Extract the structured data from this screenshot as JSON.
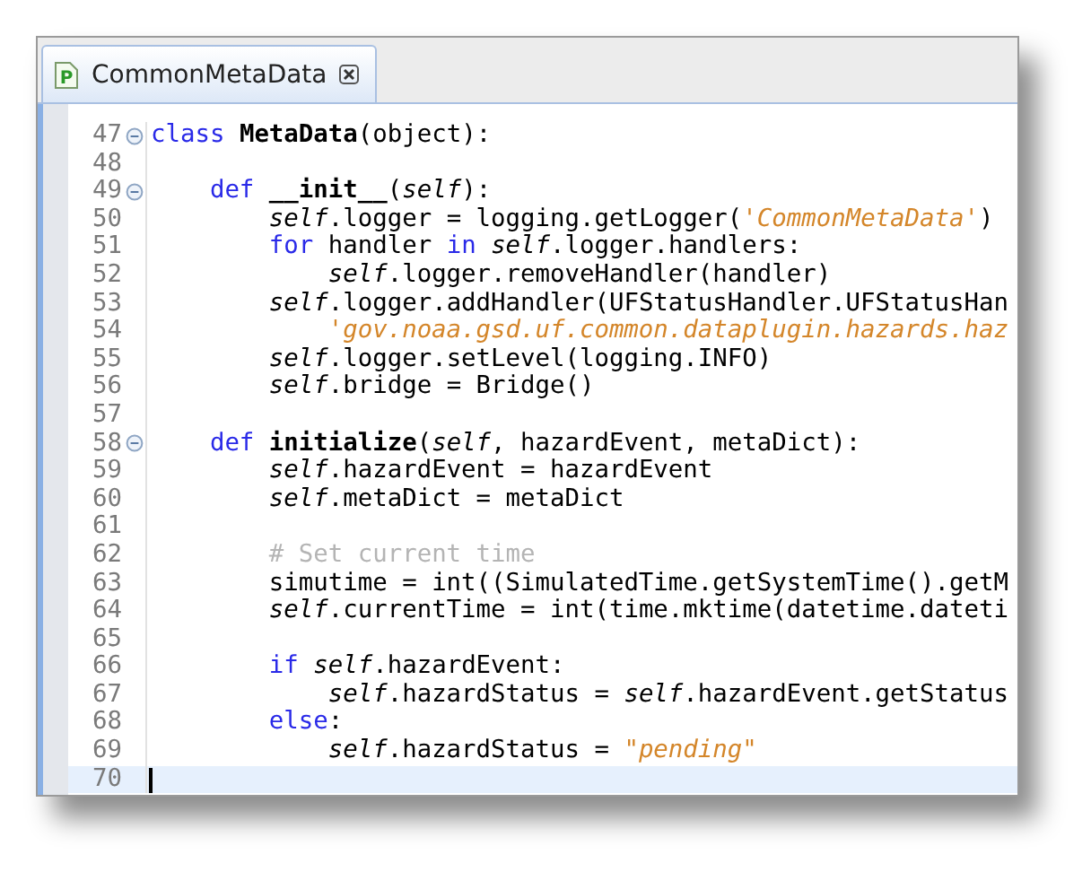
{
  "tab": {
    "icon_letter": "P",
    "label": "CommonMetaData",
    "selected": true
  },
  "lines": [
    {
      "number": "47",
      "fold": true,
      "current": false,
      "tokens": [
        {
          "kind": "kw",
          "t": "class "
        },
        {
          "kind": "bold",
          "t": "MetaData"
        },
        {
          "kind": "plain",
          "t": "(object):"
        }
      ]
    },
    {
      "number": "48",
      "fold": false,
      "current": false
    },
    {
      "number": "49",
      "fold": true,
      "current": false,
      "tokens": [
        {
          "kind": "kw",
          "t": "    def "
        },
        {
          "kind": "bold",
          "t": "__init__"
        },
        {
          "kind": "plain",
          "t": "("
        },
        {
          "kind": "self",
          "t": "self"
        },
        {
          "kind": "plain",
          "t": "):"
        }
      ]
    },
    {
      "number": "50",
      "fold": false,
      "current": false,
      "tokens": [
        {
          "kind": "self",
          "t": "        self"
        },
        {
          "kind": "plain",
          "t": ".logger = logging.getLogger("
        },
        {
          "kind": "str",
          "t": "'CommonMetaData'"
        },
        {
          "kind": "plain",
          "t": ")"
        }
      ]
    },
    {
      "number": "51",
      "fold": false,
      "current": false,
      "tokens": [
        {
          "kind": "kw",
          "t": "        for"
        },
        {
          "kind": "plain",
          "t": " handler "
        },
        {
          "kind": "kw",
          "t": "in "
        },
        {
          "kind": "self",
          "t": "self"
        },
        {
          "kind": "plain",
          "t": ".logger.handlers:"
        }
      ]
    },
    {
      "number": "52",
      "fold": false,
      "current": false,
      "tokens": [
        {
          "kind": "self",
          "t": "            self"
        },
        {
          "kind": "plain",
          "t": ".logger.removeHandler(handler)"
        }
      ]
    },
    {
      "number": "53",
      "fold": false,
      "current": false,
      "tokens": [
        {
          "kind": "self",
          "t": "        self"
        },
        {
          "kind": "plain",
          "t": ".logger.addHandler(UFStatusHandler.UFStatusHan"
        }
      ]
    },
    {
      "number": "54",
      "fold": false,
      "current": false,
      "tokens": [
        {
          "kind": "str",
          "t": "            'gov.noaa.gsd.uf.common.dataplugin.hazards.haz"
        }
      ]
    },
    {
      "number": "55",
      "fold": false,
      "current": false,
      "tokens": [
        {
          "kind": "self",
          "t": "        self"
        },
        {
          "kind": "plain",
          "t": ".logger.setLevel(logging.INFO)"
        }
      ]
    },
    {
      "number": "56",
      "fold": false,
      "current": false,
      "tokens": [
        {
          "kind": "self",
          "t": "        self"
        },
        {
          "kind": "plain",
          "t": ".bridge = Bridge()"
        }
      ]
    },
    {
      "number": "57",
      "fold": false,
      "current": false
    },
    {
      "number": "58",
      "fold": true,
      "current": false,
      "tokens": [
        {
          "kind": "kw",
          "t": "    def "
        },
        {
          "kind": "bold",
          "t": "initialize"
        },
        {
          "kind": "plain",
          "t": "("
        },
        {
          "kind": "self",
          "t": "self"
        },
        {
          "kind": "plain",
          "t": ", hazardEvent, metaDict):"
        }
      ]
    },
    {
      "number": "59",
      "fold": false,
      "current": false,
      "tokens": [
        {
          "kind": "self",
          "t": "        self"
        },
        {
          "kind": "plain",
          "t": ".hazardEvent = hazardEvent"
        }
      ]
    },
    {
      "number": "60",
      "fold": false,
      "current": false,
      "tokens": [
        {
          "kind": "self",
          "t": "        self"
        },
        {
          "kind": "plain",
          "t": ".metaDict = metaDict"
        }
      ]
    },
    {
      "number": "61",
      "fold": false,
      "current": false
    },
    {
      "number": "62",
      "fold": false,
      "current": false,
      "tokens": [
        {
          "kind": "comment",
          "t": "        # Set current time"
        }
      ]
    },
    {
      "number": "63",
      "fold": false,
      "current": false,
      "tokens": [
        {
          "kind": "plain",
          "t": "        simutime = int((SimulatedTime.getSystemTime().getM"
        }
      ]
    },
    {
      "number": "64",
      "fold": false,
      "current": false,
      "tokens": [
        {
          "kind": "self",
          "t": "        self"
        },
        {
          "kind": "plain",
          "t": ".currentTime = int(time.mktime(datetime.dateti"
        }
      ]
    },
    {
      "number": "65",
      "fold": false,
      "current": false
    },
    {
      "number": "66",
      "fold": false,
      "current": false,
      "tokens": [
        {
          "kind": "kw",
          "t": "        if "
        },
        {
          "kind": "self",
          "t": "self"
        },
        {
          "kind": "plain",
          "t": ".hazardEvent:"
        }
      ]
    },
    {
      "number": "67",
      "fold": false,
      "current": false,
      "tokens": [
        {
          "kind": "self",
          "t": "            self"
        },
        {
          "kind": "plain",
          "t": ".hazardStatus = "
        },
        {
          "kind": "self",
          "t": "self"
        },
        {
          "kind": "plain",
          "t": ".hazardEvent.getStatus"
        }
      ]
    },
    {
      "number": "68",
      "fold": false,
      "current": false,
      "tokens": [
        {
          "kind": "kw",
          "t": "        else"
        },
        {
          "kind": "plain",
          "t": ":"
        }
      ]
    },
    {
      "number": "69",
      "fold": false,
      "current": false,
      "tokens": [
        {
          "kind": "self",
          "t": "            self"
        },
        {
          "kind": "plain",
          "t": ".hazardStatus = "
        },
        {
          "kind": "str",
          "t": "\"pending\""
        }
      ]
    },
    {
      "number": "70",
      "fold": false,
      "current": true
    }
  ]
}
